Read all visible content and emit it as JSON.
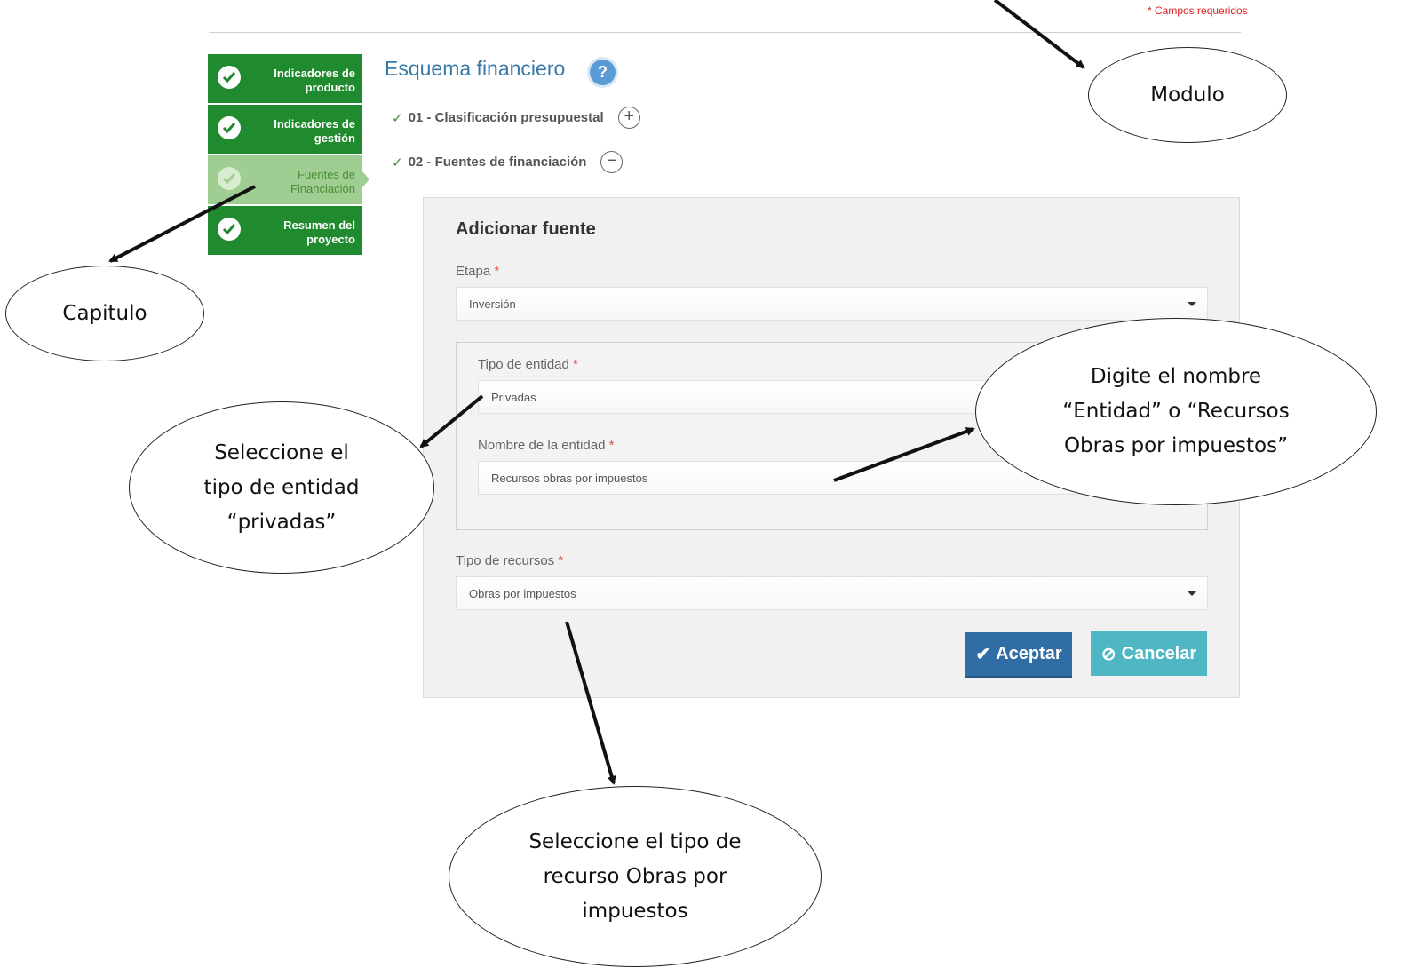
{
  "header": {
    "required_note": "* Campos requeridos"
  },
  "nav": {
    "items": [
      {
        "label": "Indicadores de producto"
      },
      {
        "label": "Indicadores de gestión"
      },
      {
        "label": "Fuentes de Financiación"
      },
      {
        "label": "Resumen del proyecto"
      }
    ],
    "active_index": 2
  },
  "module": {
    "title": "Esquema financiero",
    "help_icon": "question-circle-icon"
  },
  "accordion": [
    {
      "label": "01 - Clasificación presupuestal",
      "toggle": "+",
      "tick": "✓"
    },
    {
      "label": "02 - Fuentes de financiación",
      "toggle": "−",
      "tick": "✓"
    }
  ],
  "form": {
    "title": "Adicionar fuente",
    "etapa": {
      "label": "Etapa",
      "value": "Inversión"
    },
    "tipo_entidad": {
      "label": "Tipo de entidad",
      "value": "Privadas"
    },
    "nombre_entidad": {
      "label": "Nombre de la entidad",
      "value": "Recursos obras por impuestos"
    },
    "tipo_recursos": {
      "label": "Tipo de recursos",
      "value": "Obras por impuestos"
    },
    "required_mark": "*",
    "accept": "Aceptar",
    "cancel": "Cancelar"
  },
  "annotations": {
    "modulo": "Modulo",
    "capitulo": "Capitulo",
    "tipo_entidad": [
      "Seleccione el",
      "tipo de entidad",
      "“privadas”"
    ],
    "nombre": [
      "Digite el nombre",
      "“Entidad” o “Recursos",
      "Obras por impuestos”"
    ],
    "tipo_recurso": [
      "Seleccione el tipo de",
      "recurso Obras por",
      "impuestos"
    ]
  },
  "colors": {
    "nav_green": "#1f8a2e",
    "nav_active": "#9fcd92",
    "title_blue": "#3a7aa8",
    "accept_blue": "#2f6da4",
    "cancel_teal": "#4fb6c4",
    "required_red": "#e02020"
  }
}
